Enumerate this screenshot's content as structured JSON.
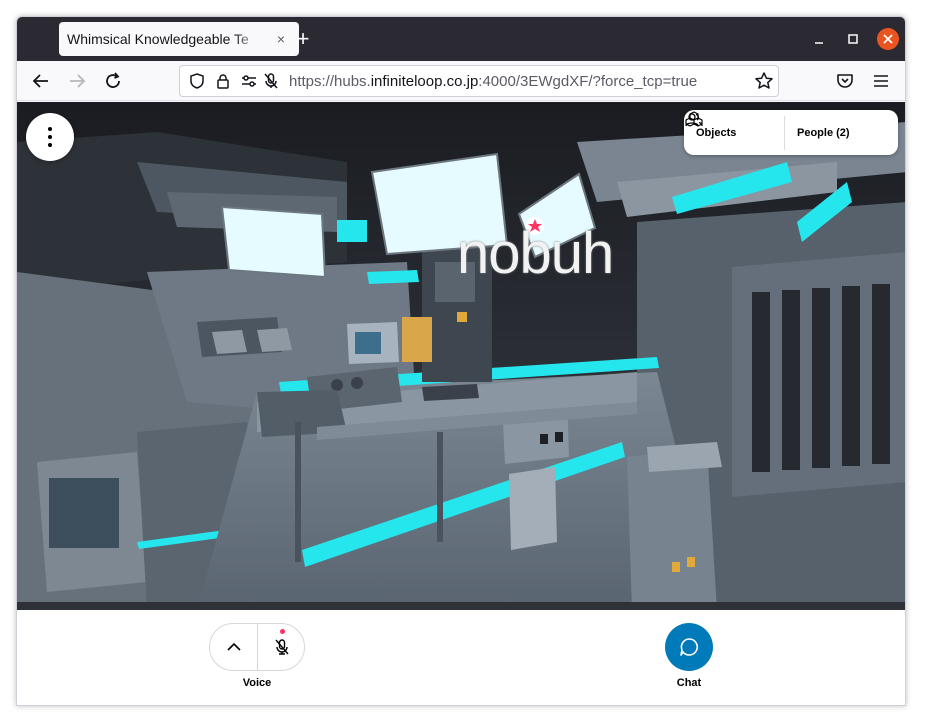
{
  "browser": {
    "tab_title": "Whimsical Knowledgeable Te",
    "tab_close": "×",
    "new_tab": "+",
    "url_prefix": "https://hubs.",
    "url_domain": "infiniteloop.co.jp",
    "url_suffix": ":4000/3EWgdXF/?force_tcp=true",
    "icons": [
      "back-arrow-icon",
      "forward-arrow-icon",
      "reload-icon",
      "shield-icon",
      "lock-icon",
      "permissions-icon",
      "mic-off-icon",
      "bookmark-star-icon",
      "pocket-icon",
      "hamburger-menu-icon",
      "minimize-icon",
      "maximize-icon",
      "close-icon"
    ]
  },
  "scene": {
    "avatar_name": "nobuh",
    "colors": {
      "accent_cyan": "#25e6ec",
      "metal": "#6a7580",
      "sky": "#1e2126",
      "screen": "#e6fbff"
    }
  },
  "top_panel": {
    "objects_label": "Objects",
    "people_label": "People (2)"
  },
  "toolbar": {
    "voice_label": "Voice",
    "chat_label": "Chat",
    "chat_color": "#007ab8",
    "mic_dot_color": "#ff3464"
  }
}
